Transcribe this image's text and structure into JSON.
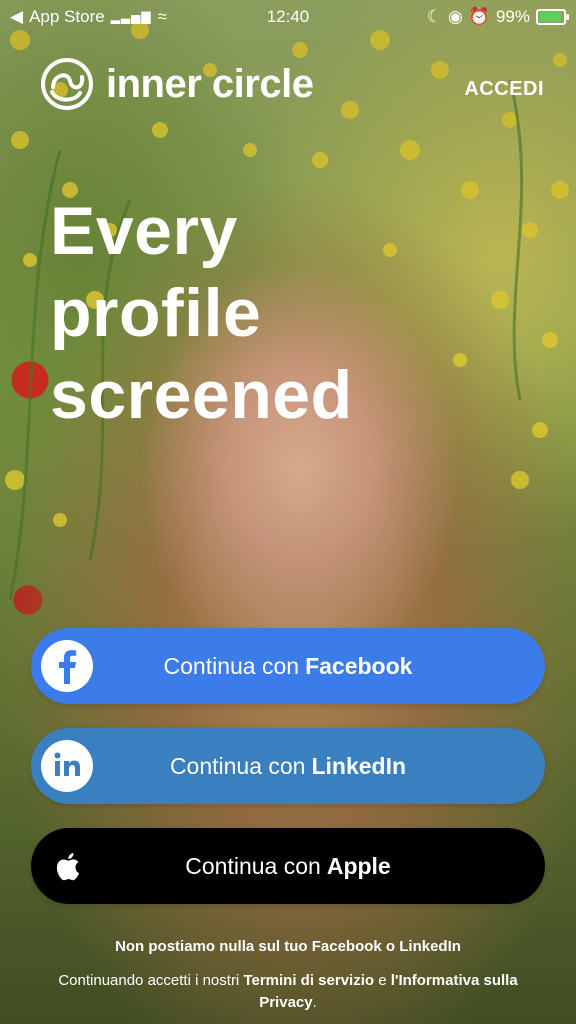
{
  "status_bar": {
    "back_app": "App Store",
    "time": "12:40",
    "battery": "99%"
  },
  "header": {
    "brand": "inner circle",
    "login": "ACCEDI"
  },
  "hero": {
    "line1": "Every",
    "line2": "profile",
    "line3": "screened"
  },
  "buttons": {
    "facebook": {
      "prefix": "Continua con",
      "provider": "Facebook"
    },
    "linkedin": {
      "prefix": "Continua con",
      "provider": "LinkedIn"
    },
    "apple": {
      "prefix": "Continua con",
      "provider": "Apple"
    }
  },
  "footer": {
    "notice": "Non postiamo nulla sul tuo Facebook o LinkedIn",
    "legal_prefix": "Continuando accetti i nostri",
    "terms": "Termini di servizio",
    "and": "e",
    "privacy": "l'Informativa sulla Privacy",
    "period": "."
  },
  "colors": {
    "facebook": "#3c7cea",
    "linkedin": "#3a7fc0",
    "apple": "#000000",
    "battery": "#5ad05a"
  },
  "icons": {
    "logo": "inner-circle-logo",
    "facebook": "facebook-icon",
    "linkedin": "linkedin-icon",
    "apple": "apple-icon"
  }
}
